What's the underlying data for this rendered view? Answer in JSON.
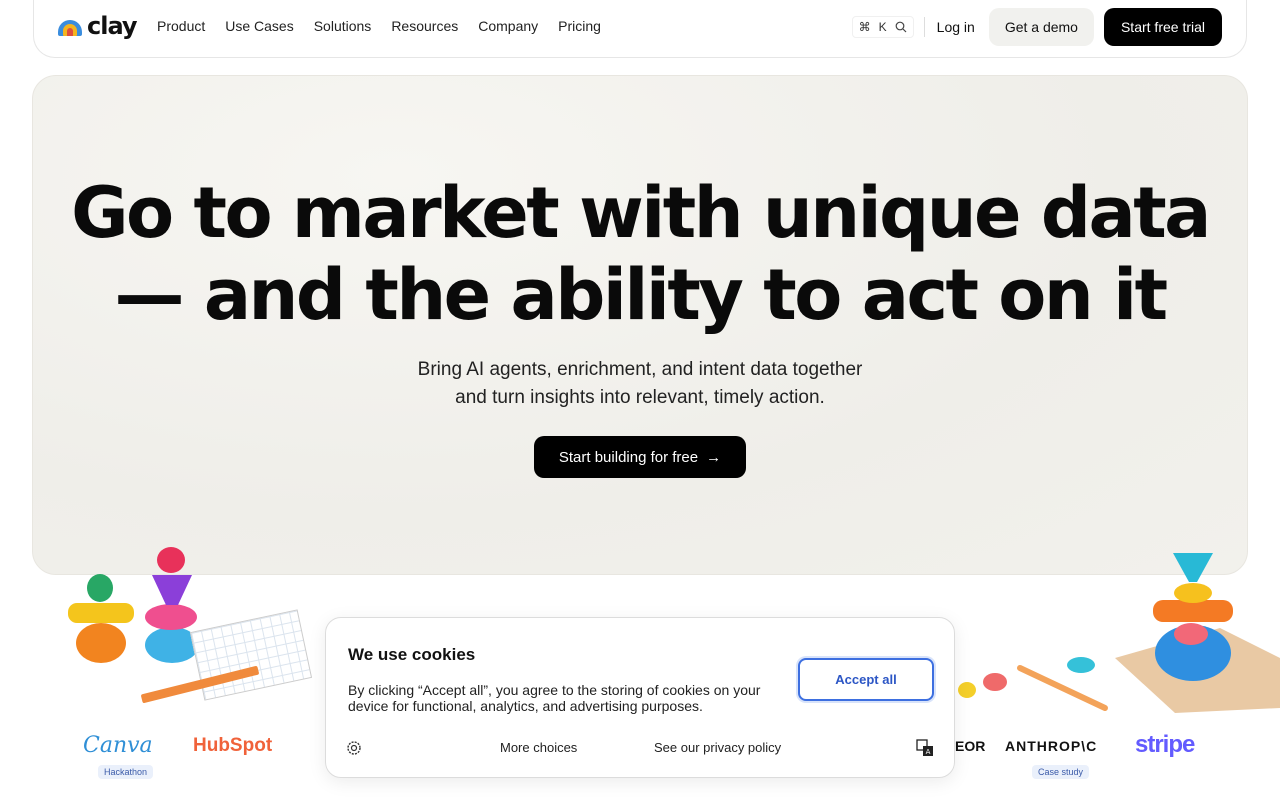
{
  "nav": {
    "logo_text": "clay",
    "menu": [
      "Product",
      "Use Cases",
      "Solutions",
      "Resources",
      "Company",
      "Pricing"
    ],
    "shortcut_cmd": "⌘",
    "shortcut_key": "K",
    "login": "Log in",
    "demo": "Get a demo",
    "trial": "Start free trial"
  },
  "hero": {
    "headline_line1": "Go to market with unique data",
    "headline_line2": "— and the ability to act on it",
    "sub_line1": "Bring AI agents, enrichment, and intent data together",
    "sub_line2": "and turn insights into relevant, timely action.",
    "cta": "Start building for free",
    "cta_arrow": "→"
  },
  "logos": {
    "canva": "Canva",
    "canva_tag": "Hackathon",
    "hubspot": "HubSpot",
    "eor": "EOR",
    "anthropic": "ANTHROP\\C",
    "anthropic_tag": "Case study",
    "stripe": "stripe"
  },
  "cookie": {
    "title": "We use cookies",
    "body": "By clicking “Accept all”, you agree to the storing of cookies on your device for functional, analytics, and advertising purposes.",
    "accept": "Accept all",
    "more": "More choices",
    "policy": "See our privacy policy"
  },
  "colors": {
    "brand_dark": "#000000",
    "accent_blue": "#3d6fe0",
    "stripe": "#635bff",
    "hubspot": "#f0623a",
    "canva": "#2f8fd6"
  }
}
